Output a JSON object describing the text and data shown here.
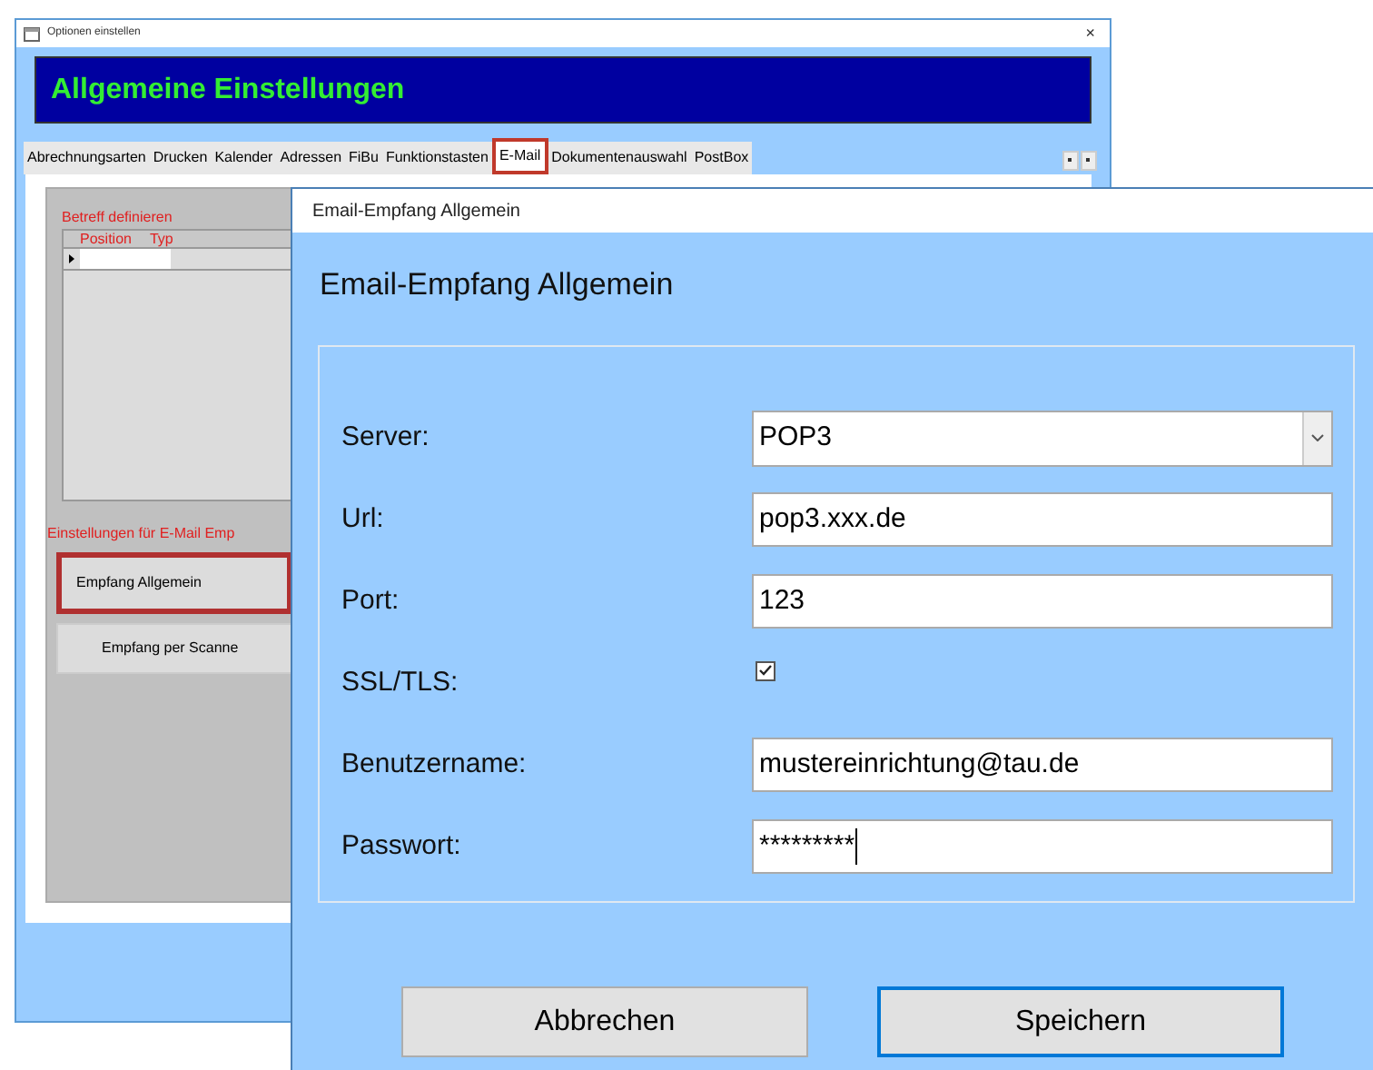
{
  "back_window": {
    "title": "Optionen einstellen",
    "close": "×",
    "header": "Allgemeine Einstellungen",
    "tabs": [
      {
        "label": "Abrechnungsarten",
        "selected": false
      },
      {
        "label": "Drucken",
        "selected": false
      },
      {
        "label": "Kalender",
        "selected": false
      },
      {
        "label": "Adressen",
        "selected": false
      },
      {
        "label": "FiBu",
        "selected": false
      },
      {
        "label": "Funktionstasten",
        "selected": false
      },
      {
        "label": "E-Mail",
        "selected": true
      },
      {
        "label": "Dokumentenauswahl",
        "selected": false
      },
      {
        "label": "PostBox",
        "selected": false
      }
    ],
    "subject_section": {
      "title": "Betreff definieren",
      "columns": [
        "Position",
        "Typ"
      ]
    },
    "email_section": {
      "title": "Einstellungen für E-Mail Emp",
      "buttons": [
        {
          "label": "Empfang Allgemein",
          "selected": true
        },
        {
          "label": "Empfang per Scanne",
          "selected": false
        }
      ]
    }
  },
  "dialog": {
    "title": "Email-Empfang Allgemein",
    "heading": "Email-Empfang Allgemein",
    "fields": [
      {
        "kind": "select",
        "label": "Server:",
        "value": "POP3"
      },
      {
        "kind": "text",
        "label": "Url:",
        "value": "pop3.xxx.de"
      },
      {
        "kind": "text",
        "label": "Port:",
        "value": "123"
      },
      {
        "kind": "checkbox",
        "label": "SSL/TLS:",
        "checked": true
      },
      {
        "kind": "text",
        "label": "Benutzername:",
        "value": "mustereinrichtung@tau.de"
      },
      {
        "kind": "password",
        "label": "Passwort:",
        "value": "*********"
      }
    ],
    "buttons": [
      {
        "label": "Abbrechen",
        "default": false
      },
      {
        "label": "Speichern",
        "default": true
      }
    ]
  }
}
